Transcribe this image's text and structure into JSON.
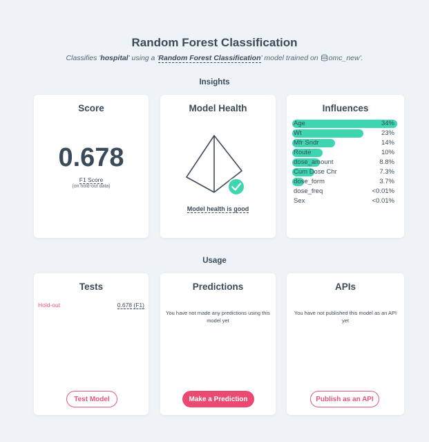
{
  "header": {
    "title": "Random Forest Classification",
    "subtitle_prefix": "Classifies '",
    "target": "hospital",
    "subtitle_mid": "' using a '",
    "model_type": "Random Forest Classification",
    "subtitle_mid2": "' model trained on",
    "dataset": "omc_new",
    "subtitle_end": "'."
  },
  "sections": {
    "insights": "Insights",
    "usage": "Usage"
  },
  "score": {
    "title": "Score",
    "value": "0.678",
    "metric": "F1 Score",
    "note": "(on hold-out data)"
  },
  "health": {
    "title": "Model Health",
    "status": "Model health is good",
    "icon": "check-icon",
    "accent": "#3dd6b0"
  },
  "influences": {
    "title": "Influences",
    "bar_color": "#3dd6b0",
    "items": [
      {
        "name": "Age",
        "value": "34%",
        "fraction": 1.0
      },
      {
        "name": "Wt",
        "value": "23%",
        "fraction": 0.68
      },
      {
        "name": "Mfr Sndr",
        "value": "14%",
        "fraction": 0.41
      },
      {
        "name": "Route",
        "value": "10%",
        "fraction": 0.29
      },
      {
        "name": "dose_amount",
        "value": "8.8%",
        "fraction": 0.26
      },
      {
        "name": "Cum Dose Chr",
        "value": "7.3%",
        "fraction": 0.21
      },
      {
        "name": "dose_form",
        "value": "3.7%",
        "fraction": 0.11
      },
      {
        "name": "dose_freq",
        "value": "<0.01%",
        "fraction": 0
      },
      {
        "name": "Sex",
        "value": "<0.01%",
        "fraction": 0
      }
    ]
  },
  "tests": {
    "title": "Tests",
    "row_name": "Hold-out",
    "row_value": "0.678",
    "row_metric": "(F1)",
    "button": "Test Model"
  },
  "predictions": {
    "title": "Predictions",
    "message": "You have not made any predictions using this model yet",
    "button": "Make a Prediction"
  },
  "apis": {
    "title": "APIs",
    "message": "You have not published this model as an API yet",
    "button": "Publish as an API"
  },
  "colors": {
    "accent_pink": "#ea4a72",
    "accent_teal": "#3dd6b0",
    "text": "#3b4a58",
    "background": "#eef3f7"
  }
}
